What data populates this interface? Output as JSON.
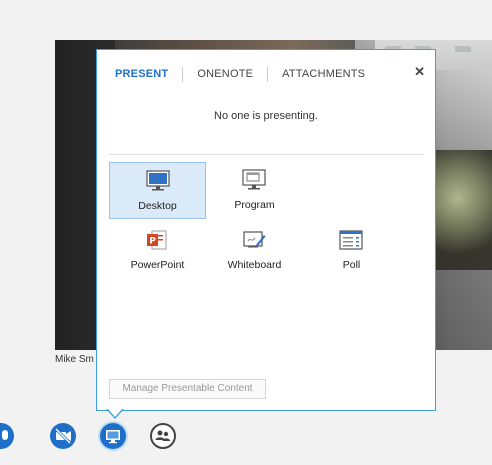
{
  "participant": {
    "name": "Mike Sm"
  },
  "popup": {
    "tabs": [
      {
        "label": "PRESENT",
        "active": true
      },
      {
        "label": "ONENOTE",
        "active": false
      },
      {
        "label": "ATTACHMENTS",
        "active": false
      }
    ],
    "close_label": "✕",
    "status_text": "No one is presenting.",
    "items": [
      {
        "label": "Desktop",
        "icon": "monitor-icon",
        "selected": true
      },
      {
        "label": "Program",
        "icon": "program-window-icon",
        "selected": false
      },
      {
        "label": "PowerPoint",
        "icon": "powerpoint-icon",
        "selected": false
      },
      {
        "label": "Whiteboard",
        "icon": "whiteboard-icon",
        "selected": false
      },
      {
        "label": "Poll",
        "icon": "poll-icon",
        "selected": false
      }
    ],
    "manage_label": "Manage Presentable Content"
  },
  "toolbar": {
    "buttons": [
      {
        "icon": "microphone-icon",
        "color": "#1e6fc8"
      },
      {
        "icon": "video-off-icon",
        "color": "#1e6fc8"
      },
      {
        "icon": "present-screen-icon",
        "color": "#1e6fc8"
      },
      {
        "icon": "participants-icon",
        "color": "#444444"
      }
    ]
  },
  "colors": {
    "accent": "#1e6fc8",
    "popup_border": "#3aa0e0",
    "selected_bg": "#dbeaf8"
  }
}
